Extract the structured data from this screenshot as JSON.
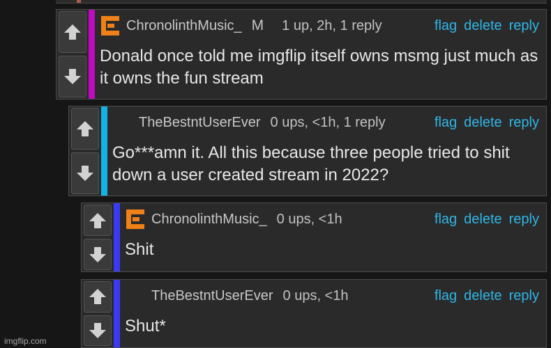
{
  "comments": [
    {
      "username": "ChronolinthMusic_",
      "badge": "M",
      "stats": "1 up, 2h, 1 reply",
      "text": "Donald once told me imgflip itself owns msmg just much as it owns the fun stream",
      "stripe_color": "#c00ac0",
      "has_avatar": true
    },
    {
      "username": "TheBestntUserEver",
      "stats": "0 ups, <1h, 1 reply",
      "text": "Go***amn it. All this because three people tried to shit down a user created stream in 2022?",
      "stripe_color": "#12b4e8",
      "has_avatar": false
    },
    {
      "username": "ChronolinthMusic_",
      "stats": "0 ups, <1h",
      "text": "Shit",
      "stripe_color": "#3a3af5",
      "has_avatar": true
    },
    {
      "username": "TheBestntUserEver",
      "stats": "0 ups, <1h",
      "text": "Shut*",
      "stripe_color": "#3a3af5",
      "has_avatar": false
    }
  ],
  "actions": {
    "flag": "flag",
    "delete": "delete",
    "reply": "reply"
  },
  "avatar_color": "#f08018",
  "watermark": "imgflip.com"
}
